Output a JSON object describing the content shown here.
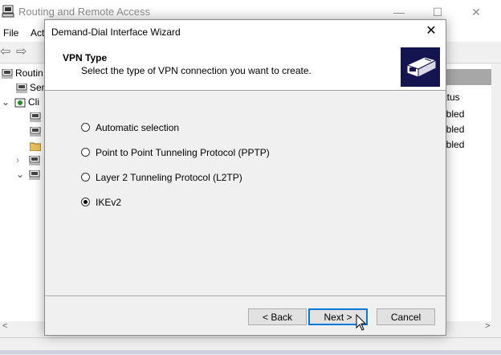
{
  "main_window": {
    "title": "Routing and Remote Access",
    "controls": {
      "minimize": "—",
      "maximize": "☐",
      "close": "✕"
    },
    "menu": [
      "File",
      "Act"
    ],
    "toolbar": {
      "back": "⇦",
      "forward": "⇨"
    },
    "tree_items": [
      {
        "label": "Routin",
        "icon": "server-icon"
      },
      {
        "label": "Ser",
        "icon": "server-icon"
      },
      {
        "label": "Cli",
        "icon": "clients-icon"
      }
    ],
    "list": {
      "column_header": "atus",
      "rows": [
        "abled",
        "abled",
        "abled"
      ]
    },
    "hscroll": {
      "left": "<",
      "right": ">"
    }
  },
  "dialog": {
    "title": "Demand-Dial Interface Wizard",
    "close_label": "✕",
    "heading": "VPN Type",
    "subheading": "Select the type of VPN connection you want to create.",
    "options": [
      {
        "label": "Automatic selection",
        "checked": false
      },
      {
        "label": "Point to Point Tunneling Protocol (PPTP)",
        "checked": false
      },
      {
        "label": "Layer 2 Tunneling Protocol (L2TP)",
        "checked": false
      },
      {
        "label": "IKEv2",
        "checked": true
      }
    ],
    "buttons": {
      "back": "< Back",
      "next": "Next >",
      "cancel": "Cancel"
    }
  },
  "colors": {
    "accent": "#0078d7",
    "header_graphic_bg": "#141450"
  }
}
